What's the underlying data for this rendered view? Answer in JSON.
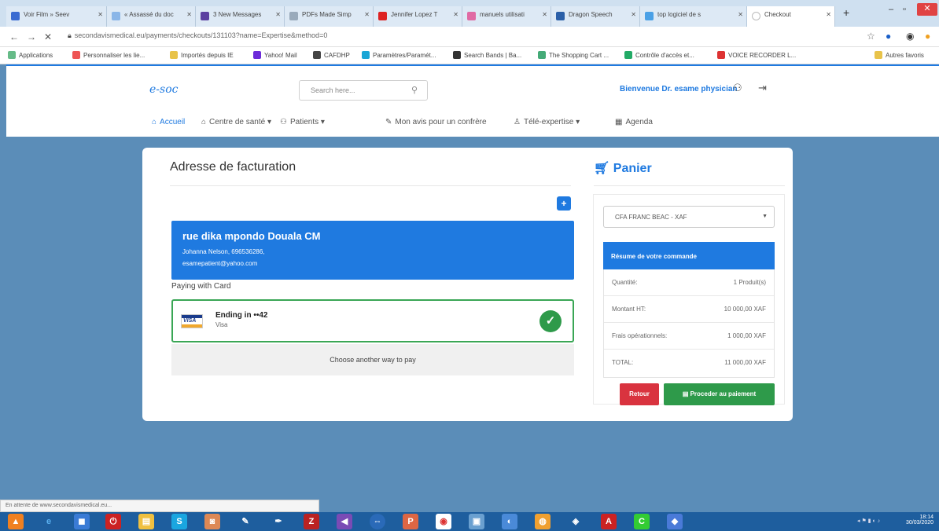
{
  "browser": {
    "tabs": [
      {
        "label": "Voir Film » Seev",
        "color": "#3a6bd1"
      },
      {
        "label": "« Assassé du doc",
        "color": "#8ab6e8"
      },
      {
        "label": "3 New Messages",
        "color": "#5b3fa0"
      },
      {
        "label": "PDFs Made Simp",
        "color": "#9ab"
      },
      {
        "label": "Jennifer Lopez T",
        "color": "#d22"
      },
      {
        "label": "manuels utilisati",
        "color": "#e06aa4"
      },
      {
        "label": "Dragon Speech",
        "color": "#2a5fa8"
      },
      {
        "label": "top logiciel de s",
        "color": "#4aa0e6"
      },
      {
        "label": "Checkout",
        "color": "#bbb"
      }
    ],
    "url": "secondavismedical.eu/payments/checkouts/131103?name=Expertise&method=0",
    "bookmarks": [
      {
        "label": "Applications",
        "color": "#6b8"
      },
      {
        "label": "Personnaliser les lie...",
        "color": "#e55"
      },
      {
        "label": "Importés depuis IE",
        "color": "#e8c34a"
      },
      {
        "label": "Yahoo! Mail",
        "color": "#6c2bd9"
      },
      {
        "label": "CAFDHP",
        "color": "#444"
      },
      {
        "label": "Paramètres/Paramét...",
        "color": "#1aa6d6"
      },
      {
        "label": "Search Bands | Ba...",
        "color": "#333"
      },
      {
        "label": "The Shopping Cart ...",
        "color": "#4a7"
      },
      {
        "label": "Contrôle d'accès et...",
        "color": "#2a6"
      },
      {
        "label": "VOICE RECORDER L...",
        "color": "#d33"
      },
      {
        "label": "Autres favoris",
        "color": "#e8c34a"
      }
    ]
  },
  "site": {
    "logo": "e-soc",
    "search_placeholder": "Search here...",
    "welcome": "Bienvenue Dr. esame physician",
    "menu": [
      {
        "label": "Accueil",
        "icon": "home-icon"
      },
      {
        "label": "Centre de santé ▾",
        "icon": "hospital-icon"
      },
      {
        "label": "Patients ▾",
        "icon": "patients-icon"
      },
      {
        "label": "Mon avis pour un confrère",
        "icon": "edit-icon"
      },
      {
        "label": "Télé-expertise ▾",
        "icon": "person-icon"
      },
      {
        "label": "Agenda",
        "icon": "calendar-icon"
      }
    ]
  },
  "billing": {
    "title": "Adresse de facturation",
    "address": {
      "street": "rue dika mpondo Douala CM",
      "line1": "Johanna Nelson, 696536286,",
      "line2": "esamepatient@yahoo.com"
    },
    "paying_label": "Paying with Card",
    "card": {
      "ending": "Ending in ••42",
      "type": "Visa"
    },
    "choose_label": "Choose another way to pay"
  },
  "cart": {
    "title": "Panier",
    "currency": "CFA FRANC BEAC - XAF",
    "summary_title": "Résume de votre commande",
    "rows": [
      {
        "k": "Quantité:",
        "v": "1 Produit(s)"
      },
      {
        "k": "Montant HT:",
        "v": "10 000,00 XAF"
      },
      {
        "k": "Frais opérationnels:",
        "v": "1 000,00 XAF"
      },
      {
        "k": "TOTAL:",
        "v": "11 000,00 XAF"
      }
    ],
    "retour_label": "Retour",
    "pay_label": "Proceder au paiement"
  },
  "status": "En attente de www.secondavismedical.eu...",
  "tray": {
    "time": "18:14",
    "date": "30/03/2020"
  },
  "colors": {
    "brand_blue": "#1f7ae0",
    "success": "#2e9a4a",
    "danger": "#d9333f",
    "page_bg": "#5b8db8"
  }
}
